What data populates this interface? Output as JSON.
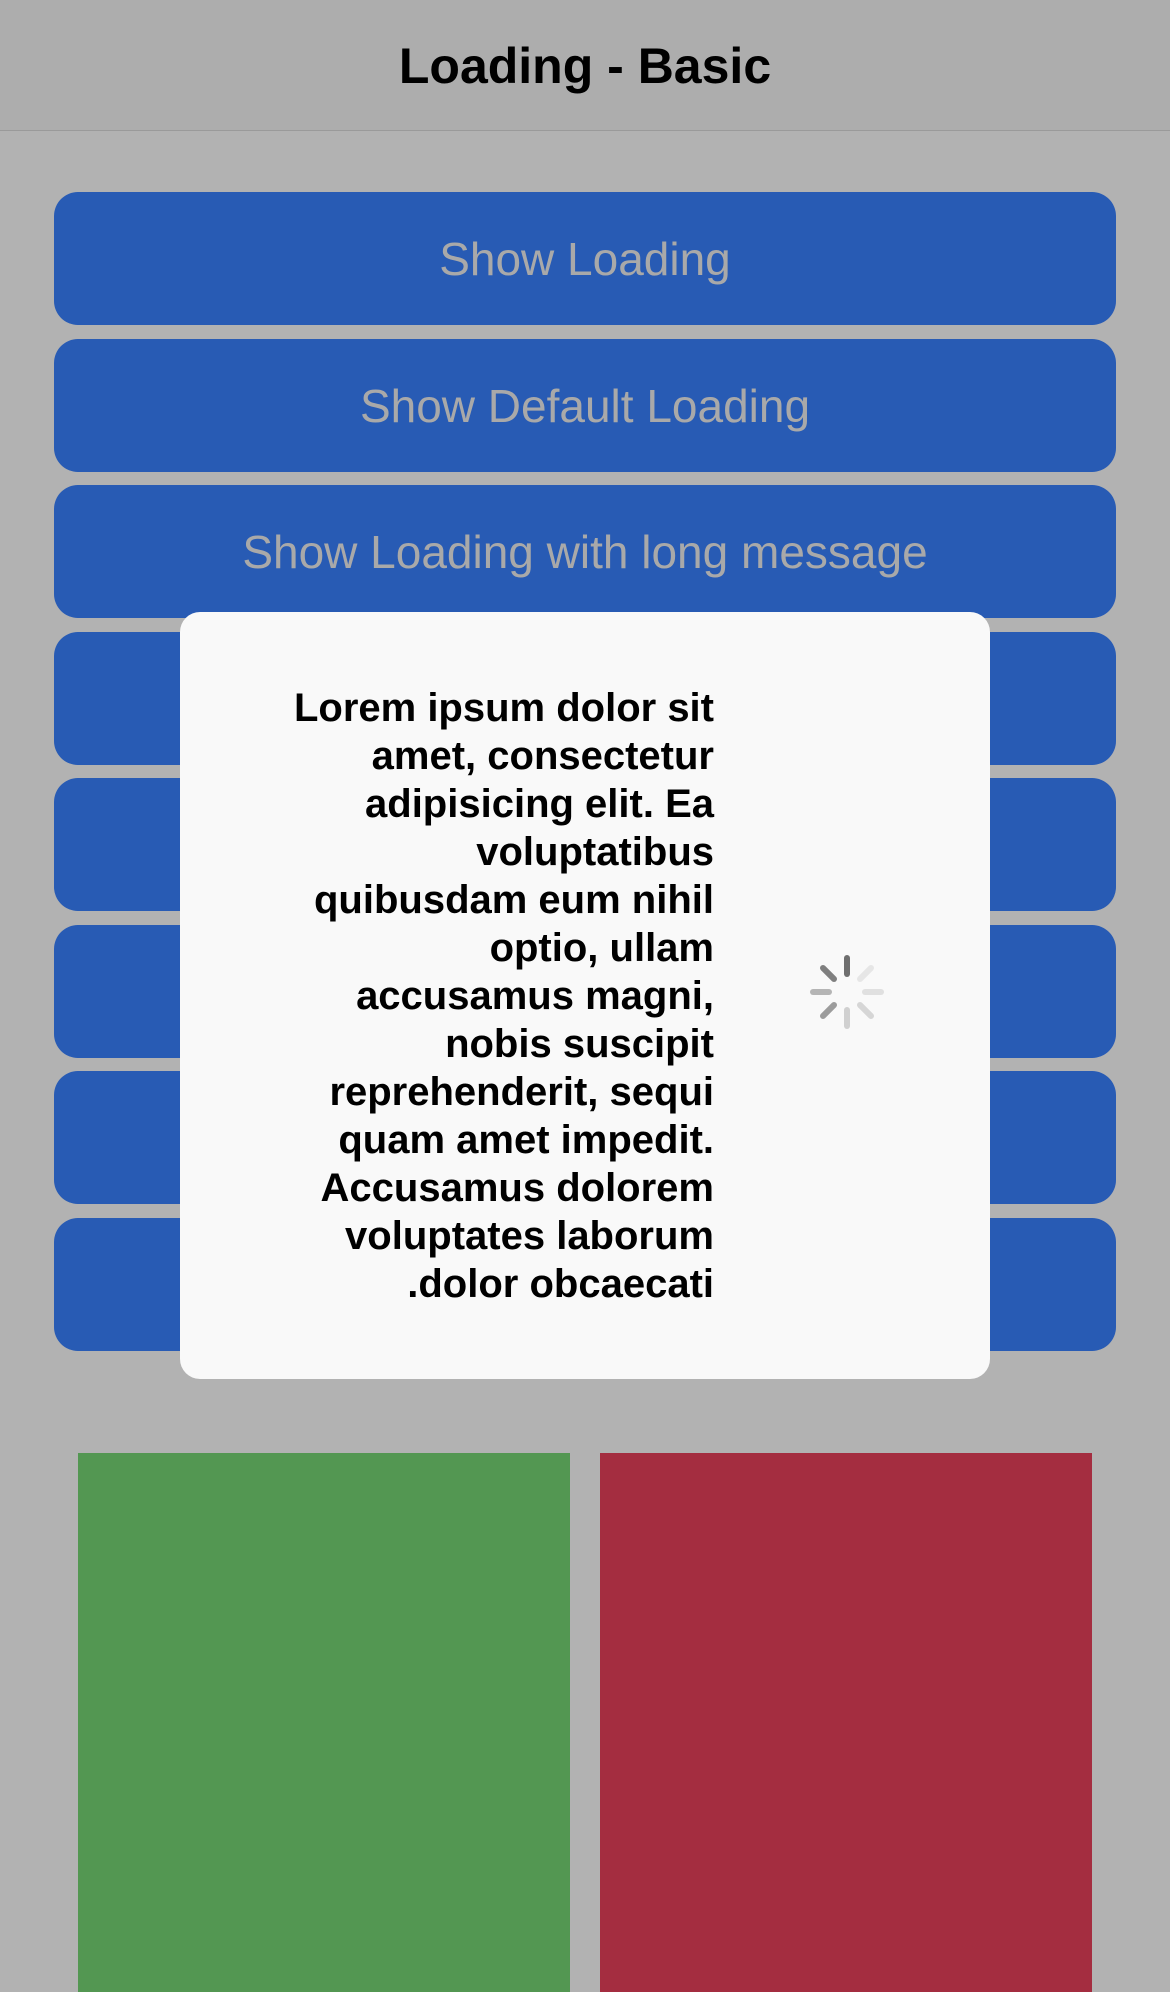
{
  "header": {
    "title": "Loading - Basic"
  },
  "buttons": [
    {
      "label": "Show Loading"
    },
    {
      "label": "Show Default Loading"
    },
    {
      "label": "Show Loading with long message"
    },
    {
      "label": ""
    },
    {
      "label": ""
    },
    {
      "label": ""
    },
    {
      "label": ""
    },
    {
      "label": ""
    }
  ],
  "loading": {
    "message": "Lorem ipsum dolor sit amet, consectetur adipisicing elit. Ea voluptatibus quibusdam eum nihil optio, ullam accusamus magni, nobis suscipit reprehenderit, sequi quam amet impedit. Accusamus dolorem voluptates laborum dolor obcaecati.",
    "spinner_icon": "spinner-icon"
  },
  "colors": {
    "button_bg": "#285bb4",
    "button_text": "#a9a9a9",
    "backdrop": "#b2b2b2",
    "green_card": "#539752",
    "red_card": "#a42d40",
    "dialog_bg": "#f9f9f9"
  }
}
